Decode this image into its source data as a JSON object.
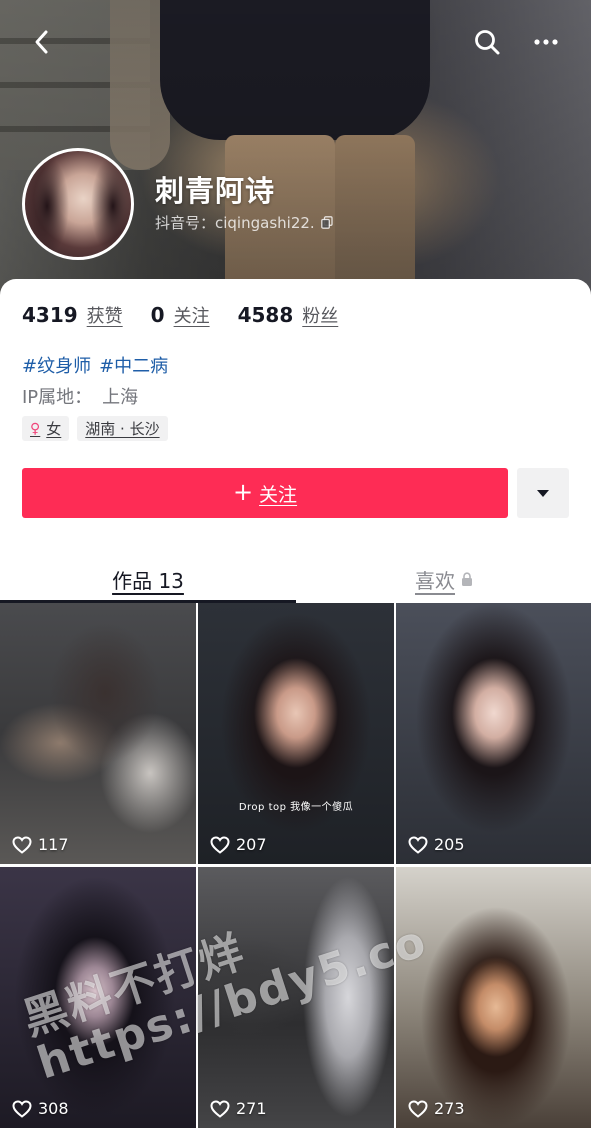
{
  "profile": {
    "nickname": "刺青阿诗",
    "douyin_id": "抖音号：ciqingashi22."
  },
  "stats": [
    {
      "value": "4319",
      "label": "获赞"
    },
    {
      "value": "0",
      "label": "关注"
    },
    {
      "value": "4588",
      "label": "粉丝"
    }
  ],
  "bio": {
    "tags": [
      "#纹身师",
      "#中二病"
    ],
    "ip_label": "IP属地：",
    "ip_value": "上海"
  },
  "chips": {
    "gender_symbol": "♀",
    "gender": "女",
    "location": "湖南 · 长沙"
  },
  "actions": {
    "follow_plus": "+",
    "follow_label": "关注"
  },
  "tabs": {
    "works": "作品 13",
    "likes": "喜欢"
  },
  "videos": [
    {
      "likes": "117",
      "caption": ""
    },
    {
      "likes": "207",
      "caption": "Drop top 我像一个傻瓜"
    },
    {
      "likes": "205",
      "caption": ""
    },
    {
      "likes": "308",
      "caption": ""
    },
    {
      "likes": "271",
      "caption": ""
    },
    {
      "likes": "273",
      "caption": ""
    }
  ],
  "watermark": {
    "line1": "黑料不打烊",
    "line2": "https://bdy5.co"
  },
  "icons": {
    "back": "back-chevron-icon",
    "search": "search-icon",
    "more": "more-dots-icon",
    "copy": "copy-icon",
    "dropdown": "triangle-down-icon",
    "lock": "lock-icon",
    "heart": "heart-outline-icon"
  },
  "colors": {
    "accent": "#fe2c55",
    "link": "#1f5ea8"
  }
}
